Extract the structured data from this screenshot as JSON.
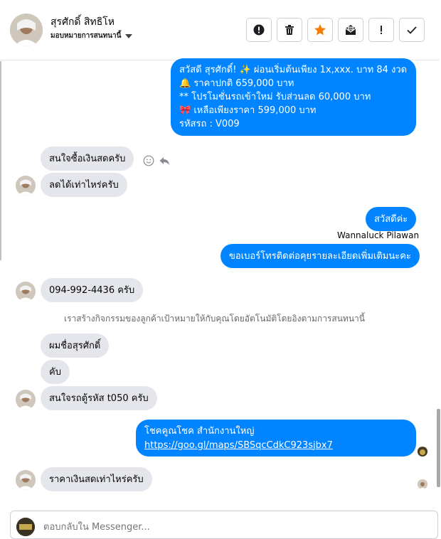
{
  "header": {
    "contact_name": "สุรศักดิ์ สิทธิโห",
    "assign_label": "มอบหมายการสนทนานี้",
    "buttons": [
      {
        "icon": "alert-circle-icon"
      },
      {
        "icon": "trash-icon"
      },
      {
        "icon": "star-icon"
      },
      {
        "icon": "mark-unread-icon"
      },
      {
        "icon": "exclamation-icon"
      },
      {
        "icon": "check-icon"
      }
    ],
    "accent_star": "#f57c00"
  },
  "messages": {
    "promo": {
      "line1": "สวัสดี สุรศักดิ์! ✨  ผ่อนเริ่มต้นเพียง 1x,xxx. บาท 84 งวด",
      "line2": "🔔 ราคาปกติ 659,000 บาท",
      "line3": "** โปรโมชั่นรถเข้าใหม่ รับส่วนลด 60,000 บาท",
      "line4": "🎀  เหลือเพียงราคา 599,000 บาท",
      "line5": "รหัสรถ : V009"
    },
    "in1": "สนใจซื้อเงินสดครับ",
    "in2": "ลดได้เท่าไหร่ครับ",
    "out_hello": "สวัสดีค่ะ",
    "agent_name": "Wannaluck Pilawan",
    "out_ask_phone": "ขอเบอร์โทรติดต่อคุยรายละเอียดเพิ่มเติมนะคะ",
    "in_phone": "094-992-4436 ครับ",
    "system_note": "เราสร้างกิจกรรมของลูกค้าเป้าหมายให้กับคุณโดยอัตโนมัติโดยอิงตามการสนทนานี้",
    "in_name": "ผมชื่อสุรศักดิ์",
    "in_kub": "คับ",
    "in_interest": "สนใจรถตู้รหัส t050 ครับ",
    "out_location_title": "โชคคูณโชค สำนักงานใหญ่",
    "out_location_link": "https://goo.gl/maps/SBSqcCdkC923sjbx7",
    "in_cash_price": "ราคาเงินสดเท่าไหร่ครับ"
  },
  "composer": {
    "placeholder": "ตอบกลับใน Messenger..."
  },
  "colors": {
    "outgoing": "#0084ff",
    "incoming": "#e4e6eb"
  }
}
